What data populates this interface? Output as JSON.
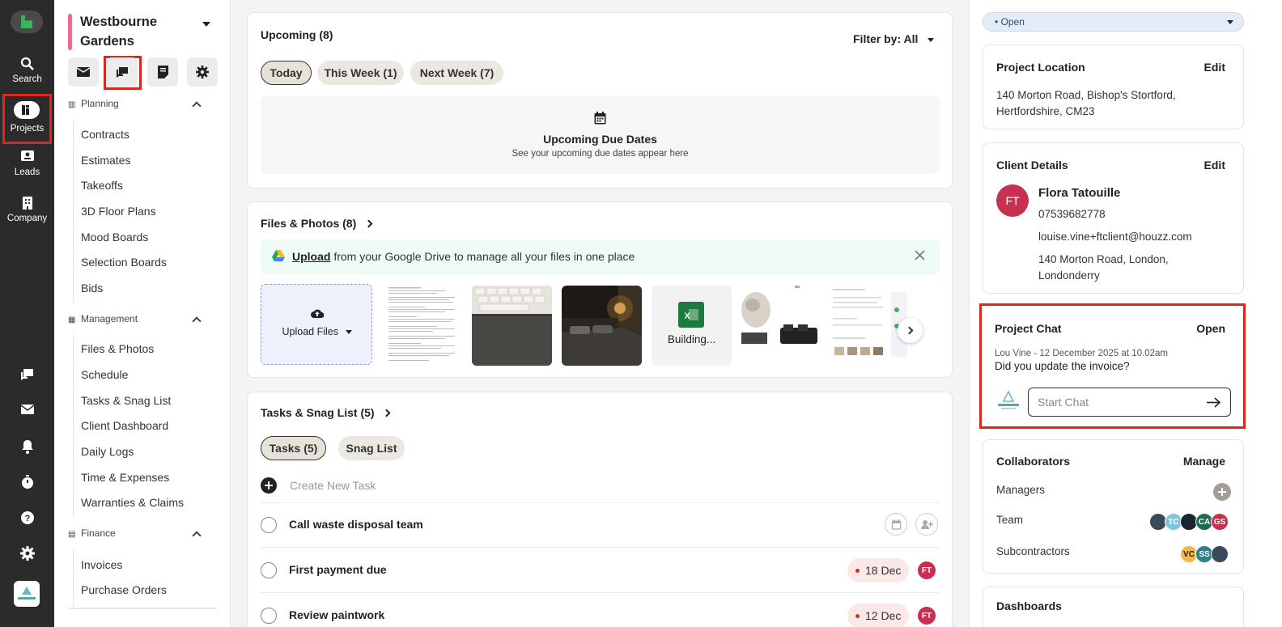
{
  "rail": {
    "items": [
      {
        "label": "Search",
        "icon": "search-icon"
      },
      {
        "label": "Projects",
        "icon": "projects-icon"
      },
      {
        "label": "Leads",
        "icon": "leads-icon"
      },
      {
        "label": "Company",
        "icon": "company-icon"
      }
    ],
    "bottom_icons": [
      "chat-icon",
      "mail-icon",
      "bell-icon",
      "timer-icon",
      "help-icon",
      "settings-icon"
    ]
  },
  "project": {
    "name": "Westbourne Gardens",
    "quick_actions": [
      "mail-icon",
      "chat-icon",
      "invoice-icon",
      "settings-icon"
    ]
  },
  "nav": {
    "planning": {
      "title": "Planning",
      "links": [
        "Contracts",
        "Estimates",
        "Takeoffs",
        "3D Floor Plans",
        "Mood Boards",
        "Selection Boards",
        "Bids"
      ]
    },
    "management": {
      "title": "Management",
      "links": [
        "Files & Photos",
        "Schedule",
        "Tasks & Snag List",
        "Client Dashboard",
        "Daily Logs",
        "Time & Expenses",
        "Warranties & Claims"
      ]
    },
    "finance": {
      "title": "Finance",
      "links": [
        "Invoices",
        "Purchase Orders"
      ]
    }
  },
  "upcoming": {
    "title": "Upcoming (8)",
    "filter_label": "Filter by: All",
    "tabs": [
      "Today",
      "This Week (1)",
      "Next Week (7)"
    ],
    "empty_title": "Upcoming Due Dates",
    "empty_subtitle": "See your upcoming due dates appear here"
  },
  "files": {
    "title": "Files & Photos (8)",
    "banner_link": "Upload",
    "banner_text": " from your Google Drive to manage all your files in one place",
    "upload_label": "Upload Files",
    "excel_label": "Building..."
  },
  "tasks": {
    "title": "Tasks & Snag List (5)",
    "tabs": [
      "Tasks (5)",
      "Snag List"
    ],
    "create_label": "Create New Task",
    "rows": [
      {
        "name": "Call waste disposal team",
        "date": "",
        "assignee": ""
      },
      {
        "name": "First payment due",
        "date": "18 Dec",
        "assignee": "FT"
      },
      {
        "name": "Review paintwork",
        "date": "12 Dec",
        "assignee": "FT"
      }
    ]
  },
  "right": {
    "status": "• Open",
    "location": {
      "title": "Project Location",
      "action": "Edit",
      "address_line1": "140 Morton Road, Bishop's Stortford,",
      "address_line2": "Hertfordshire, CM23"
    },
    "client": {
      "title": "Client Details",
      "action": "Edit",
      "initials": "FT",
      "name": "Flora Tatouille",
      "phone": "07539682778",
      "email": "louise.vine+ftclient@houzz.com",
      "address_line1": "140 Morton Road, London,",
      "address_line2": "Londonderry"
    },
    "chat": {
      "title": "Project Chat",
      "action": "Open",
      "meta": "Lou Vine - 12 December 2025 at 10.02am",
      "message": "Did you update the invoice?",
      "placeholder": "Start Chat"
    },
    "collaborators": {
      "title": "Collaborators",
      "action": "Manage",
      "managers_label": "Managers",
      "team_label": "Team",
      "subcontractors_label": "Subcontractors",
      "team_avatars": [
        "TC",
        "CA",
        "GS"
      ],
      "sub_avatars": [
        "VC",
        "SS"
      ]
    },
    "dashboards": {
      "title": "Dashboards"
    }
  },
  "colors": {
    "accent_red": "#e0261b",
    "brand_green": "#38b55b",
    "project_accent": "#f06b8c"
  }
}
